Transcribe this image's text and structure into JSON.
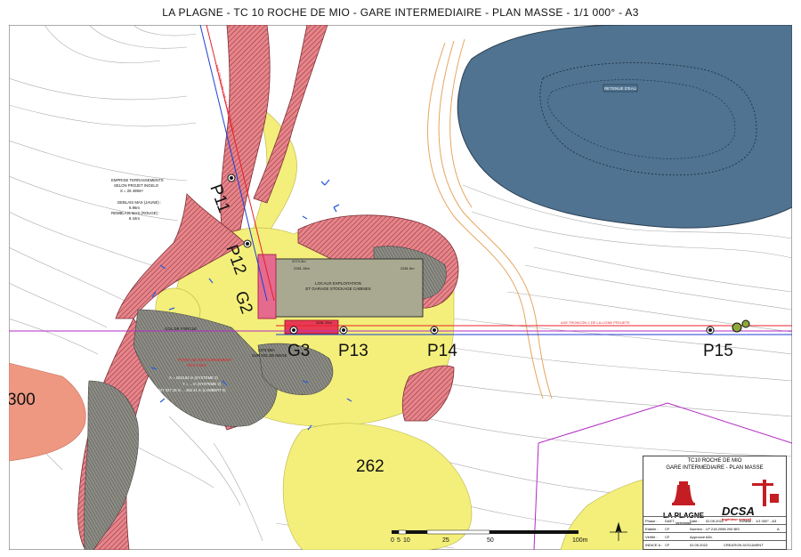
{
  "title": "LA PLAGNE - TC 10 ROCHE DE MIO -  GARE INTERMEDIAIRE - PLAN MASSE - 1/1 000° - A3",
  "colors": {
    "deblais_yellow": "#f3ef7a",
    "remblais_red": "#e9838a",
    "terrain_gray": "#8d8d86",
    "water_blue": "#4f7391",
    "cable_red": "#e8202a",
    "cable_blue": "#1e3fd6",
    "boundary_magenta": "#b32ac4",
    "track_orange": "#e6a55e"
  },
  "map_labels": {
    "retenue": "RETENUE D'EAU",
    "emprise": [
      "EMPRISE TERRASSEMENTS",
      "SELON PROJET INGELO",
      "S = 26 499m²"
    ],
    "deblais": [
      "DEBLAIS MAX (JAUNE) :",
      "8.96m"
    ],
    "remblais": [
      "REMBLAIS MAX (ROUGE) :",
      "8.44m"
    ],
    "locaux": [
      "LOCAUX EXPLOITATION",
      "ET GARAGE STOCKAGE CABINES"
    ],
    "col": "COL DE FORCLE",
    "point_retournement": [
      "POINT DE RETOURNEMENT",
      "DES AXES"
    ],
    "coords": [
      "X = 2043.82 m (SYSTEME 2)",
      "Y = ... m (SYSTEME 2)",
      "X = 947 027.16 m ... 452.41 m (LAMBERT II)"
    ],
    "sur_sol": [
      "2273.50m",
      "SUR SOL DE NEIGE"
    ],
    "elev": [
      "2274.3m",
      "2281.15m",
      "2281.5m",
      "2281.15m"
    ],
    "axe_nord": "AXE TRONCON 1 DE LA LIGNE PROJETE",
    "axe_est": "AXE TRONCON 2 DE LA LIGNE PROJETE"
  },
  "pylons": [
    "P11",
    "P12",
    "G2",
    "G3",
    "P13",
    "P14",
    "P15"
  ],
  "zone_labels": [
    "300",
    "262"
  ],
  "scale_bar": {
    "ticks": [
      "0",
      "5",
      "10",
      "25",
      "50",
      "100m"
    ]
  },
  "cartouche": {
    "project": "TC10 ROCHE DE MIO",
    "subtitle": "GARE INTERMEDIAIRE - PLAN MASSE",
    "client_name": "LA PLAGNE",
    "client_sub": "tarentaise",
    "firm_name": "DCSA",
    "firm_sub": "Ingénieur conseil",
    "rows": [
      {
        "k": "Phase :",
        "v": "DAET",
        "k2": "Date :",
        "v2": "02.05.2022",
        "k3": "Echelle :",
        "v3": "1/1 000° - A3"
      },
      {
        "k": "Etablie :",
        "v": "CF",
        "k2": "Numéro :",
        "v2": "LP 218.2098 200 BIS",
        "k3": "",
        "v3": "A"
      },
      {
        "k": "Vérifié :",
        "v": "CF",
        "k2": "Approuvé :",
        "v2": "ADL",
        "k3": "",
        "v3": ""
      },
      {
        "k": "INDICE A :",
        "v": "CF",
        "k2": "02.05.2022",
        "v2": "CREATION DOCUMENT",
        "k3": "",
        "v3": ""
      }
    ]
  }
}
